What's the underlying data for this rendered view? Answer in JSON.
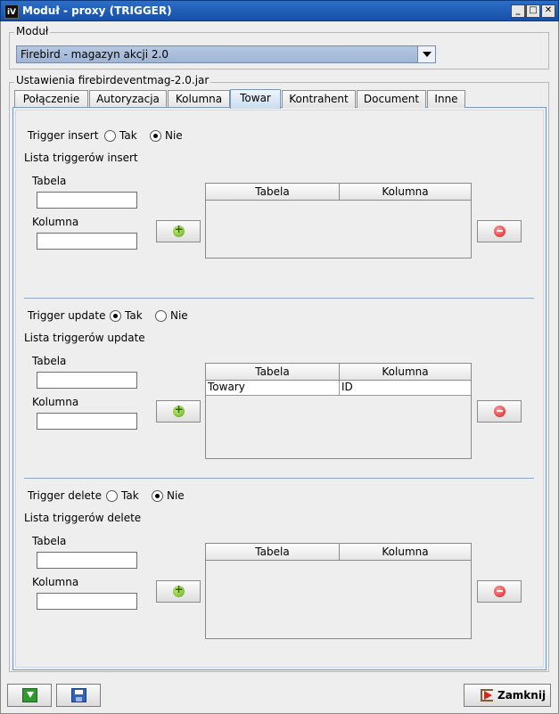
{
  "window": {
    "icon_text": "iV",
    "title": "Moduł - proxy (TRIGGER)",
    "minimize": "_",
    "maximize": "□",
    "close": "✕"
  },
  "module_group": {
    "legend": "Moduł",
    "selected": "Firebird - magazyn akcji 2.0"
  },
  "settings_group": {
    "legend": "Ustawienia firebirdeventmag-2.0.jar"
  },
  "tabs": [
    {
      "label": "Połączenie",
      "active": false
    },
    {
      "label": "Autoryzacja",
      "active": false
    },
    {
      "label": "Kolumna",
      "active": false
    },
    {
      "label": "Towar",
      "active": true
    },
    {
      "label": "Kontrahent",
      "active": false
    },
    {
      "label": "Document",
      "active": false
    },
    {
      "label": "Inne",
      "active": false
    }
  ],
  "sections": {
    "insert": {
      "title": "Trigger insert",
      "option_yes": "Tak",
      "option_no": "Nie",
      "selected": "Nie",
      "list_label": "Lista triggerów insert",
      "table_label": "Tabela",
      "column_label": "Kolumna",
      "table_value": "",
      "column_value": "",
      "headers": [
        "Tabela",
        "Kolumna"
      ],
      "rows": []
    },
    "update": {
      "title": "Trigger update",
      "option_yes": "Tak",
      "option_no": "Nie",
      "selected": "Tak",
      "list_label": "Lista triggerów update",
      "table_label": "Tabela",
      "column_label": "Kolumna",
      "table_value": "",
      "column_value": "",
      "headers": [
        "Tabela",
        "Kolumna"
      ],
      "rows": [
        [
          "Towary",
          "ID"
        ]
      ]
    },
    "delete": {
      "title": "Trigger delete",
      "option_yes": "Tak",
      "option_no": "Nie",
      "selected": "Nie",
      "list_label": "Lista triggerów delete",
      "table_label": "Tabela",
      "column_label": "Kolumna",
      "table_value": "",
      "column_value": "",
      "headers": [
        "Tabela",
        "Kolumna"
      ],
      "rows": []
    }
  },
  "footer": {
    "close_label": "Zamknij"
  },
  "icons": {
    "add": "plus-circle-icon",
    "remove": "minus-circle-icon",
    "download": "download-icon",
    "save": "floppy-icon",
    "exit": "exit-door-icon"
  },
  "colors": {
    "titlebar": "#1f5cb8",
    "accent_tab": "#c9dcf2",
    "add_icon": "#5fa51b",
    "remove_icon": "#d11c1c"
  }
}
